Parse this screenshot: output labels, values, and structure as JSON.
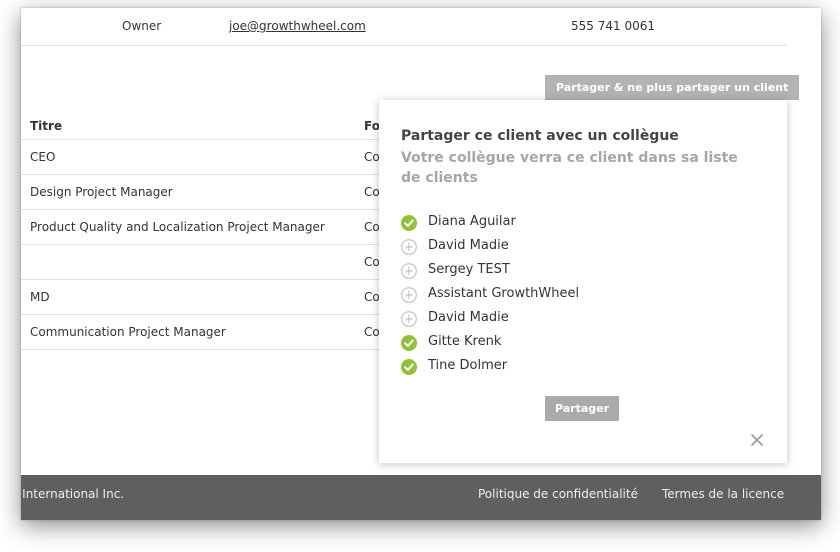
{
  "owner_row": {
    "role": "Owner",
    "email": "joe@growthwheel.com",
    "phone": "555 741 0061"
  },
  "share_button_label": "Partager & ne plus partager un client",
  "contacts": {
    "headers": {
      "title": "Titre",
      "function": "Fo"
    },
    "rows": [
      {
        "title": "CEO",
        "function": "Co"
      },
      {
        "title": "Design Project Manager",
        "function": "Co"
      },
      {
        "title": "Product Quality and Localization Project Manager",
        "function": "Co"
      },
      {
        "title": "",
        "function": "Co"
      },
      {
        "title": "MD",
        "function": "Co"
      },
      {
        "title": "Communication Project Manager",
        "function": "Co"
      }
    ]
  },
  "popup": {
    "title": "Partager ce client avec un collègue",
    "subtitle": "Votre collègue verra ce client dans sa liste de clients",
    "colleagues": [
      {
        "name": "Diana Aguilar",
        "icon": "check-circle-icon"
      },
      {
        "name": "David Madie",
        "icon": "plus-circle-icon"
      },
      {
        "name": "Sergey TEST",
        "icon": "plus-circle-icon"
      },
      {
        "name": "Assistant GrowthWheel",
        "icon": "plus-circle-icon"
      },
      {
        "name": "David Madie",
        "icon": "plus-circle-icon"
      },
      {
        "name": "Gitte Krenk",
        "icon": "check-circle-icon"
      },
      {
        "name": "Tine Dolmer",
        "icon": "check-circle-icon"
      }
    ],
    "share_label": "Partager",
    "close_icon": "close-icon"
  },
  "footer": {
    "company": "l International Inc.",
    "privacy": "Politique de confidentialité",
    "license": "Termes de la licence"
  },
  "colors": {
    "accent_check": "#8fc23a",
    "button_gray": "#b3b3b3",
    "footer_bg": "#5f5f5f"
  }
}
